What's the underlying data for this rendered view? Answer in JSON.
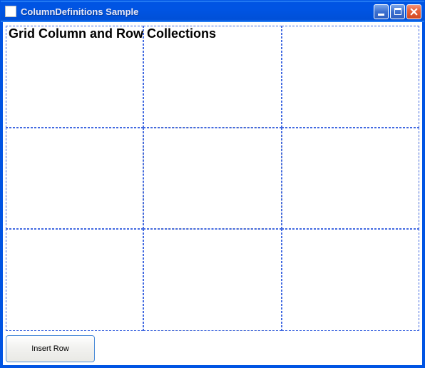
{
  "window": {
    "title": "ColumnDefinitions Sample"
  },
  "main": {
    "heading": "Grid Column and Row Collections",
    "grid": {
      "columns": 3,
      "rows": 3
    }
  },
  "buttons": {
    "insertRow": "Insert Row"
  },
  "colors": {
    "titlebar_gradient_top": "#3a95ff",
    "titlebar_gradient_mid": "#0054e3",
    "grid_dash_color1": "#b8860b",
    "grid_dash_color2": "#4169e1",
    "close_btn": "#e8623a"
  }
}
